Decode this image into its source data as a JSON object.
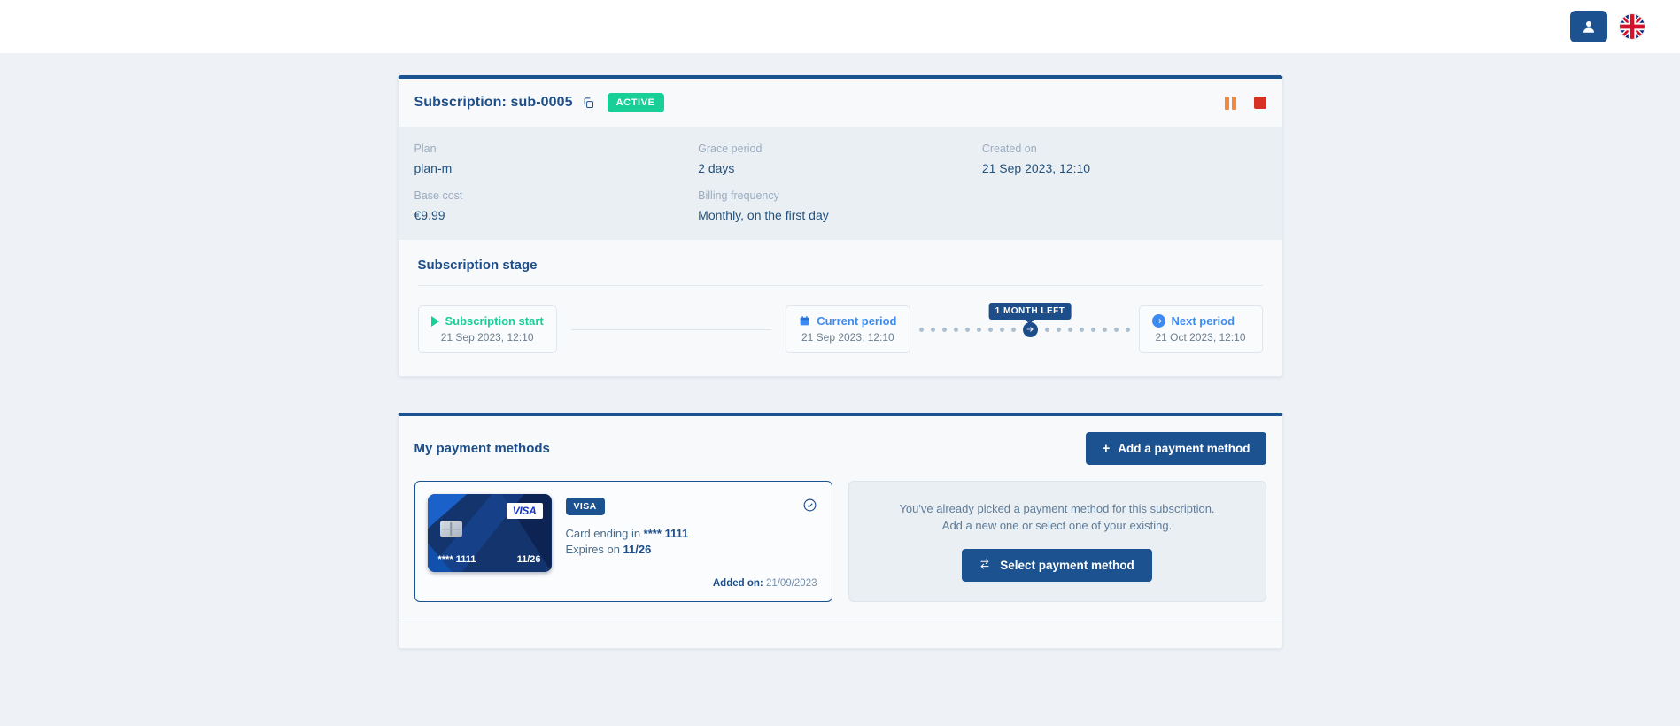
{
  "topbar": {
    "account_icon": "user-icon",
    "language_flag": "uk-flag-icon"
  },
  "subscription": {
    "title": "Subscription: sub-0005",
    "copy_icon": "copy-icon",
    "status_badge": "ACTIVE",
    "actions": {
      "pause_icon": "pause-icon",
      "stop_icon": "stop-icon"
    },
    "details": [
      {
        "label": "Plan",
        "value": "plan-m"
      },
      {
        "label": "Grace period",
        "value": "2 days"
      },
      {
        "label": "Created on",
        "value": "21 Sep 2023, 12:10"
      },
      {
        "label": "Base cost",
        "value": "€9.99"
      },
      {
        "label": "Billing frequency",
        "value": "Monthly, on the first day"
      }
    ],
    "stage": {
      "heading": "Subscription stage",
      "start": {
        "label": "Subscription start",
        "date": "21 Sep 2023, 12:10",
        "icon": "play-icon"
      },
      "current": {
        "label": "Current period",
        "date": "21 Sep 2023, 12:10",
        "icon": "calendar-icon"
      },
      "next": {
        "label": "Next period",
        "date": "21 Oct 2023, 12:10",
        "icon": "arrow-right-circle-icon"
      },
      "tooltip": "1 MONTH LEFT",
      "dots_before": 9,
      "dots_after": 8
    }
  },
  "payment_methods": {
    "heading": "My payment methods",
    "add_button": {
      "label": "Add a payment method",
      "icon": "plus-icon"
    },
    "selected_card": {
      "brand_tag": "VISA",
      "card_logo": "VISA",
      "card_number_masked": "**** 1111",
      "card_expiry_short": "11/26",
      "ending_prefix": "Card ending in ",
      "ending_value": "**** 1111",
      "expires_prefix": "Expires on ",
      "expires_value": "11/26",
      "added_on_label": "Added on:",
      "added_on_value": "21/09/2023",
      "selected_icon": "check-circle-icon"
    },
    "empty_panel": {
      "message_line1": "You've already picked a payment method for this subscription.",
      "message_line2": "Add a new one or select one of your existing.",
      "select_button": {
        "label": "Select payment method",
        "icon": "swap-icon"
      }
    }
  },
  "colors": {
    "brand_navy": "#1c5290",
    "accent_teal": "#17cf97",
    "accent_blue": "#3d8bf2",
    "warning_orange": "#f5873a",
    "danger_red": "#d93025"
  }
}
